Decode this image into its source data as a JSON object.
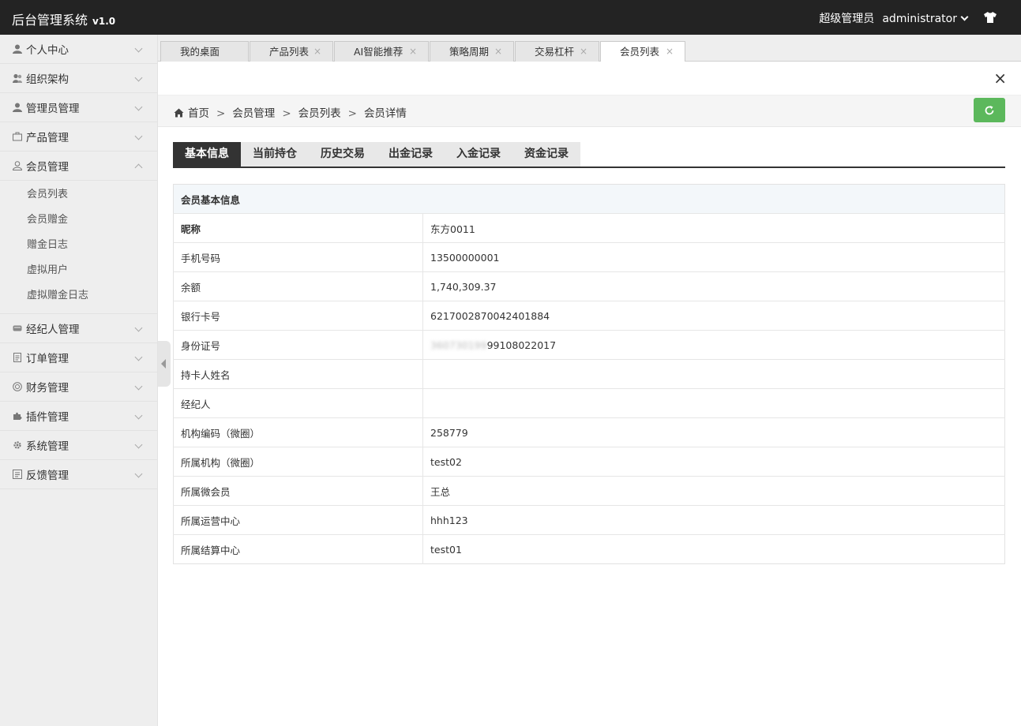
{
  "header": {
    "title": "后台管理系统",
    "version": "v1.0",
    "role": "超级管理员",
    "username": "administrator"
  },
  "sidebar": {
    "items": [
      {
        "label": "个人中心",
        "icon": "user-icon"
      },
      {
        "label": "组织架构",
        "icon": "users-icon"
      },
      {
        "label": "管理员管理",
        "icon": "user-icon"
      },
      {
        "label": "产品管理",
        "icon": "briefcase-icon"
      },
      {
        "label": "会员管理",
        "icon": "user-outline-icon",
        "expanded": true,
        "children": [
          "会员列表",
          "会员赠金",
          "赠金日志",
          "虚拟用户",
          "虚拟赠金日志"
        ]
      },
      {
        "label": "经纪人管理",
        "icon": "card-icon"
      },
      {
        "label": "订单管理",
        "icon": "file-icon"
      },
      {
        "label": "财务管理",
        "icon": "coin-icon"
      },
      {
        "label": "插件管理",
        "icon": "puzzle-icon"
      },
      {
        "label": "系统管理",
        "icon": "gear-icon"
      },
      {
        "label": "反馈管理",
        "icon": "feedback-icon"
      }
    ]
  },
  "tabs": [
    {
      "label": "我的桌面",
      "closable": false
    },
    {
      "label": "产品列表",
      "closable": true
    },
    {
      "label": "AI智能推荐",
      "closable": true
    },
    {
      "label": "策略周期",
      "closable": true
    },
    {
      "label": "交易杠杆",
      "closable": true
    },
    {
      "label": "会员列表",
      "closable": true,
      "active": true
    }
  ],
  "tab_close_glyph": "×",
  "close_glyph": "×",
  "breadcrumb": {
    "items": [
      "首页",
      "会员管理",
      "会员列表",
      "会员详情"
    ],
    "separator": ">"
  },
  "content_tabs": [
    "基本信息",
    "当前持仓",
    "历史交易",
    "出金记录",
    "入金记录",
    "资金记录"
  ],
  "info": {
    "section_title": "会员基本信息",
    "rows": [
      {
        "key": "昵称",
        "value": "东方0011"
      },
      {
        "key": "手机号码",
        "value": "13500000001"
      },
      {
        "key": "余额",
        "value": "1,740,309.37"
      },
      {
        "key": "银行卡号",
        "value": "6217002870042401884"
      },
      {
        "key": "身份证号",
        "value": "99108022017",
        "blurred_prefix": "360730199"
      },
      {
        "key": "持卡人姓名",
        "value": ""
      },
      {
        "key": "经纪人",
        "value": ""
      },
      {
        "key": "机构编码（微圈）",
        "value": "258779"
      },
      {
        "key": "所属机构（微圈）",
        "value": "test02"
      },
      {
        "key": "所属微会员",
        "value": "王总"
      },
      {
        "key": "所属运营中心",
        "value": "hhh123"
      },
      {
        "key": "所属结算中心",
        "value": "test01"
      }
    ]
  },
  "colors": {
    "header_bg": "#232323",
    "sidebar_bg": "#eeeeee",
    "refresh_green": "#5cb85c",
    "active_tab": "#333333"
  }
}
